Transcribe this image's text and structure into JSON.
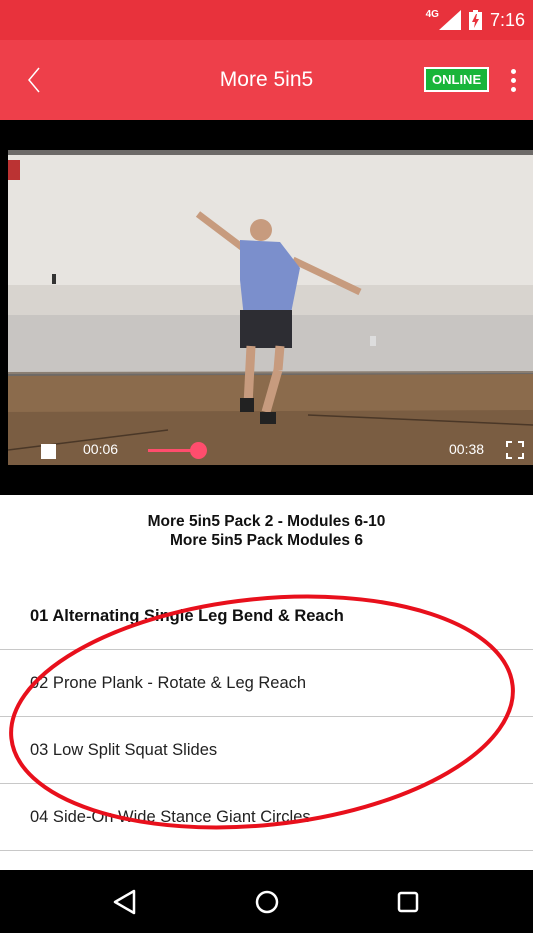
{
  "status_bar": {
    "network": "4G",
    "time": "7:16"
  },
  "app_bar": {
    "title": "More 5in5",
    "badge": "ONLINE",
    "colors": {
      "status": "#e8323c",
      "toolbar": "#ee3f4a",
      "badge": "#19b53a"
    }
  },
  "video": {
    "current_time": "00:06",
    "total_time": "00:38",
    "progress": 0.16,
    "accent": "#ff4d6d"
  },
  "info": {
    "line1": "More 5in5 Pack 2 - Modules 6-10",
    "line2": "More 5in5 Pack Modules 6"
  },
  "exercises": [
    {
      "label": "01 Alternating Single Leg Bend & Reach",
      "active": true
    },
    {
      "label": "02 Prone Plank - Rotate & Leg Reach",
      "active": false
    },
    {
      "label": "03 Low Split Squat Slides",
      "active": false
    },
    {
      "label": "04 Side-On Wide Stance Giant Circles",
      "active": false
    }
  ],
  "icons": {
    "back": "chevron-left-icon",
    "menu": "more-vert-icon",
    "stop": "stop-icon",
    "fullscreen": "fullscreen-icon",
    "nav_back": "triangle-back-icon",
    "nav_home": "circle-home-icon",
    "nav_recents": "square-recents-icon"
  }
}
